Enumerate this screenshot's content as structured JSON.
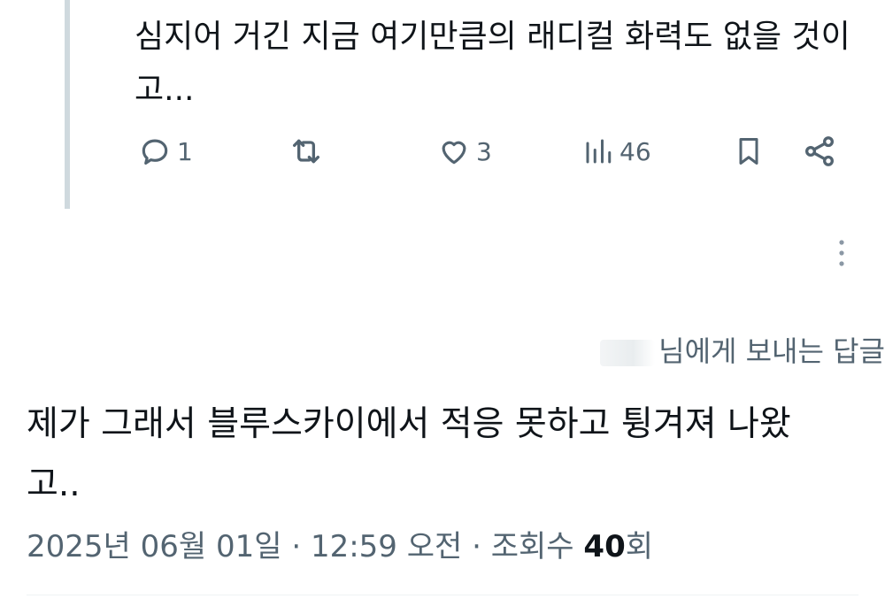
{
  "reply_tweet": {
    "text": "심지어 거긴 지금 여기만큼의 래디컬 화력도 없을 것이고...",
    "actions": {
      "reply_count": "1",
      "retweet_count": "",
      "like_count": "3",
      "views_count": "46"
    }
  },
  "main_tweet": {
    "replying_to_suffix": "님에게 보내는 답글",
    "text": "제가 그래서 블루스카이에서 적응 못하고 튕겨져 나왔고..",
    "date": "2025년 06월 01일",
    "separator": "·",
    "time": "12:59 오전",
    "views_label": "조회수",
    "views_count": "40",
    "views_unit": "회"
  },
  "colors": {
    "text_primary": "#0f1419",
    "text_secondary": "#536471",
    "thread_line": "#cfd9de"
  }
}
